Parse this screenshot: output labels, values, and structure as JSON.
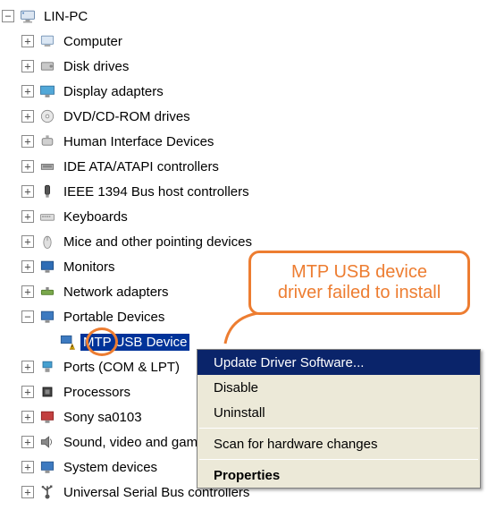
{
  "root": {
    "label": "LIN-PC",
    "expanded": true
  },
  "children": [
    {
      "label": "Computer",
      "icon": "computer",
      "expanded": false,
      "hasChildren": true
    },
    {
      "label": "Disk drives",
      "icon": "disk",
      "expanded": false,
      "hasChildren": true
    },
    {
      "label": "Display adapters",
      "icon": "display",
      "expanded": false,
      "hasChildren": true
    },
    {
      "label": "DVD/CD-ROM drives",
      "icon": "cdrom",
      "expanded": false,
      "hasChildren": true
    },
    {
      "label": "Human Interface Devices",
      "icon": "hid",
      "expanded": false,
      "hasChildren": true
    },
    {
      "label": "IDE ATA/ATAPI controllers",
      "icon": "ide",
      "expanded": false,
      "hasChildren": true
    },
    {
      "label": "IEEE 1394 Bus host controllers",
      "icon": "ieee",
      "expanded": false,
      "hasChildren": true
    },
    {
      "label": "Keyboards",
      "icon": "keyboard",
      "expanded": false,
      "hasChildren": true
    },
    {
      "label": "Mice and other pointing devices",
      "icon": "mouse",
      "expanded": false,
      "hasChildren": true
    },
    {
      "label": "Monitors",
      "icon": "monitor",
      "expanded": false,
      "hasChildren": true
    },
    {
      "label": "Network adapters",
      "icon": "network",
      "expanded": false,
      "hasChildren": true
    },
    {
      "label": "Portable Devices",
      "icon": "portable",
      "expanded": true,
      "hasChildren": true,
      "children": [
        {
          "label": "MTP USB Device",
          "icon": "portable-warn",
          "selected": true,
          "hasProblem": true
        }
      ]
    },
    {
      "label": "Ports (COM & LPT)",
      "icon": "ports",
      "expanded": false,
      "hasChildren": true
    },
    {
      "label": "Processors",
      "icon": "processor",
      "expanded": false,
      "hasChildren": true
    },
    {
      "label": "Sony sa0103",
      "icon": "sony",
      "expanded": false,
      "hasChildren": true
    },
    {
      "label": "Sound, video and game controllers",
      "icon": "sound",
      "expanded": false,
      "hasChildren": true
    },
    {
      "label": "System devices",
      "icon": "system",
      "expanded": false,
      "hasChildren": true
    },
    {
      "label": "Universal Serial Bus controllers",
      "icon": "usb",
      "expanded": false,
      "hasChildren": true
    }
  ],
  "callout": {
    "line1": "MTP USB device",
    "line2": "driver failed to install"
  },
  "context_menu": {
    "items": [
      {
        "label": "Update Driver Software...",
        "highlighted": true
      },
      {
        "label": "Disable"
      },
      {
        "label": "Uninstall"
      },
      {
        "sep": true
      },
      {
        "label": "Scan for hardware changes"
      },
      {
        "sep": true
      },
      {
        "label": "Properties",
        "bold": true
      }
    ]
  }
}
